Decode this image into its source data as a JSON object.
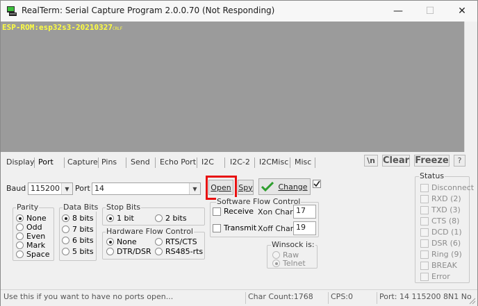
{
  "window": {
    "title": "RealTerm: Serial Capture Program 2.0.0.70 (Not Responding)",
    "minimize": "—",
    "maximize": "☐",
    "close": "✕"
  },
  "terminal": {
    "text": "ESP-ROM:esp32s3-20210327",
    "crlf": "CRLF",
    "bg_color": "#9b9b9b",
    "text_color": "#ffff40"
  },
  "tabs": [
    "Display",
    "Port",
    "Capture",
    "Pins",
    "Send",
    "Echo Port",
    "I2C",
    "I2C-2",
    "I2CMisc",
    "Misc"
  ],
  "active_tab": "Port",
  "tab_buttons": {
    "newline": "\\n",
    "clear": "Clear",
    "freeze": "Freeze",
    "help": "?"
  },
  "port": {
    "baud_label": "Baud",
    "baud_value": "115200",
    "port_label": "Port",
    "port_value": "14",
    "open_button": "Open",
    "spy_button": "Spy",
    "change_button": "Change",
    "change_checkbox_checked": false
  },
  "parity": {
    "title": "Parity",
    "options": [
      "None",
      "Odd",
      "Even",
      "Mark",
      "Space"
    ],
    "selected": "None"
  },
  "data_bits": {
    "title": "Data Bits",
    "options": [
      "8 bits",
      "7 bits",
      "6 bits",
      "5 bits"
    ],
    "selected": "8 bits"
  },
  "stop_bits": {
    "title": "Stop Bits",
    "options": [
      "1 bit",
      "2 bits"
    ],
    "selected": "1 bit"
  },
  "hardware_flow": {
    "title": "Hardware Flow Control",
    "options": [
      "None",
      "RTS/CTS",
      "DTR/DSR",
      "RS485-rts"
    ],
    "selected": "None"
  },
  "software_flow": {
    "title": "Software Flow Control",
    "receive_label": "Receive",
    "transmit_label": "Transmit",
    "xon_label": "Xon Char:",
    "xon_value": "17",
    "xoff_label": "Xoff Char:",
    "xoff_value": "19"
  },
  "winsock": {
    "title": "Winsock is:",
    "options": [
      "Raw",
      "Telnet"
    ],
    "selected": "Telnet"
  },
  "status": {
    "title": "Status",
    "items": [
      "Disconnect",
      "RXD (2)",
      "TXD (3)",
      "CTS (8)",
      "DCD (1)",
      "DSR (6)",
      "Ring (9)",
      "BREAK",
      "Error"
    ]
  },
  "statusbar": {
    "hint": "Use this if you want to have no ports open...",
    "char_count": "Char Count:1768",
    "cps": "CPS:0",
    "port_info": "Port: 14 115200 8N1 No"
  }
}
